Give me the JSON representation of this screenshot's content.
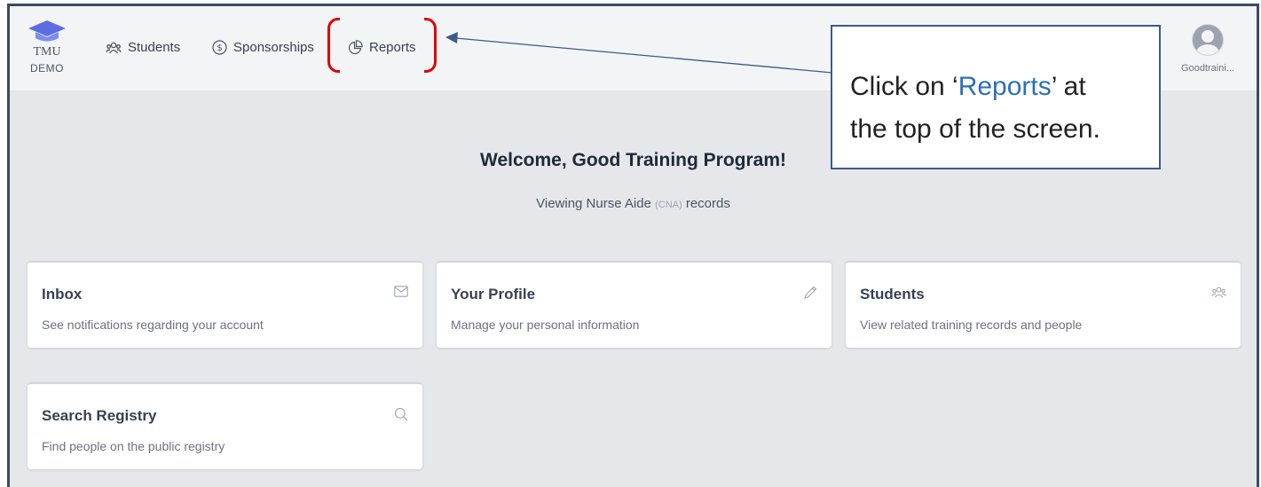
{
  "logo": {
    "name": "TMU",
    "env": "DEMO"
  },
  "nav": [
    {
      "label": "Students",
      "icon": "users-icon"
    },
    {
      "label": "Sponsorships",
      "icon": "dollar-circle-icon"
    },
    {
      "label": "Reports",
      "icon": "pie-chart-icon"
    }
  ],
  "user": {
    "name": "Goodtraini..."
  },
  "welcome": {
    "title": "Welcome, Good Training Program!",
    "sub_prefix": "Viewing Nurse Aide",
    "sub_code": "(CNA)",
    "sub_suffix": "records"
  },
  "cards": [
    {
      "title": "Inbox",
      "desc": "See notifications regarding your account",
      "icon": "mail-icon"
    },
    {
      "title": "Your Profile",
      "desc": "Manage your personal information",
      "icon": "pencil-icon"
    },
    {
      "title": "Students",
      "desc": "View related training records and people",
      "icon": "users-icon"
    },
    {
      "title": "Search Registry",
      "desc": "Find people on the public registry",
      "icon": "search-icon"
    }
  ],
  "annotation": {
    "pre": "Click on ‘",
    "highlight": "Reports",
    "post": "’ at",
    "line2": "the top of the screen."
  },
  "colors": {
    "annotation_highlight": "#2e6fb7",
    "bracket": "#e00000",
    "brand": "#5b6ee1"
  }
}
